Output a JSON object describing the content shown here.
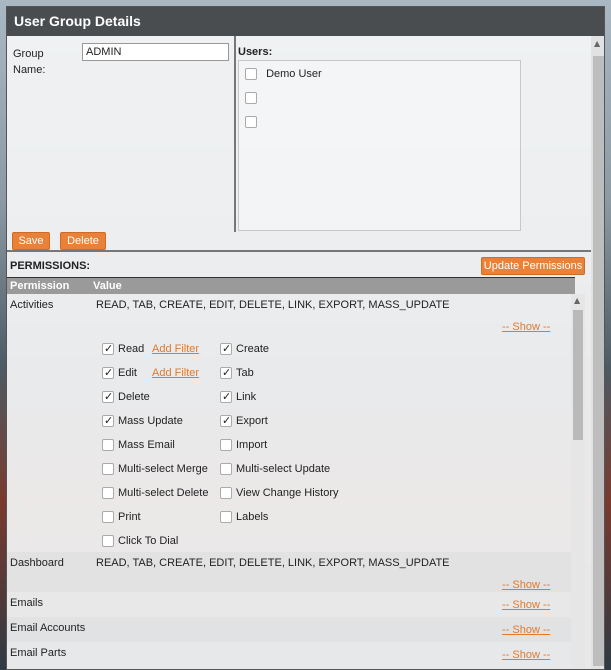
{
  "window": {
    "title": "User Group Details"
  },
  "group": {
    "label": "Group Name:",
    "value": "ADMIN"
  },
  "users": {
    "label": "Users:",
    "items": [
      {
        "name": "Demo User",
        "checked": false
      },
      {
        "name": "",
        "checked": false
      },
      {
        "name": "",
        "checked": false
      }
    ]
  },
  "buttons": {
    "save": "Save",
    "delete": "Delete",
    "update_permissions": "Update Permissions"
  },
  "permissions": {
    "label": "PERMISSIONS:",
    "columns": {
      "permission": "Permission",
      "value": "Value"
    },
    "rows": [
      {
        "name": "Activities",
        "value": "READ, TAB, CREATE, EDIT, DELETE, LINK, EXPORT, MASS_UPDATE",
        "show": "-- Show --"
      },
      {
        "name": "Dashboard",
        "value": "READ, TAB, CREATE, EDIT, DELETE, LINK, EXPORT, MASS_UPDATE",
        "show": "-- Show --"
      },
      {
        "name": "Emails",
        "value": "",
        "show": "-- Show --"
      },
      {
        "name": "Email Accounts",
        "value": "",
        "show": "-- Show --"
      },
      {
        "name": "Email Parts",
        "value": "",
        "show": "-- Show --"
      }
    ],
    "activity_options_left": [
      {
        "label": "Read",
        "checked": true,
        "filter": "Add Filter"
      },
      {
        "label": "Edit",
        "checked": true,
        "filter": "Add Filter"
      },
      {
        "label": "Delete",
        "checked": true
      },
      {
        "label": "Mass Update",
        "checked": true
      },
      {
        "label": "Mass Email",
        "checked": false
      },
      {
        "label": "Multi-select Merge",
        "checked": false
      },
      {
        "label": "Multi-select Delete",
        "checked": false
      },
      {
        "label": "Print",
        "checked": false
      },
      {
        "label": "Click To Dial",
        "checked": false
      }
    ],
    "activity_options_right": [
      {
        "label": "Create",
        "checked": true
      },
      {
        "label": "Tab",
        "checked": true
      },
      {
        "label": "Link",
        "checked": true
      },
      {
        "label": "Export",
        "checked": true
      },
      {
        "label": "Import",
        "checked": false
      },
      {
        "label": "Multi-select Update",
        "checked": false
      },
      {
        "label": "View Change History",
        "checked": false
      },
      {
        "label": "Labels",
        "checked": false
      }
    ]
  },
  "colors": {
    "accent": "#e8823a",
    "titlebar": "#4a4d50",
    "link": "#e07a2e"
  }
}
